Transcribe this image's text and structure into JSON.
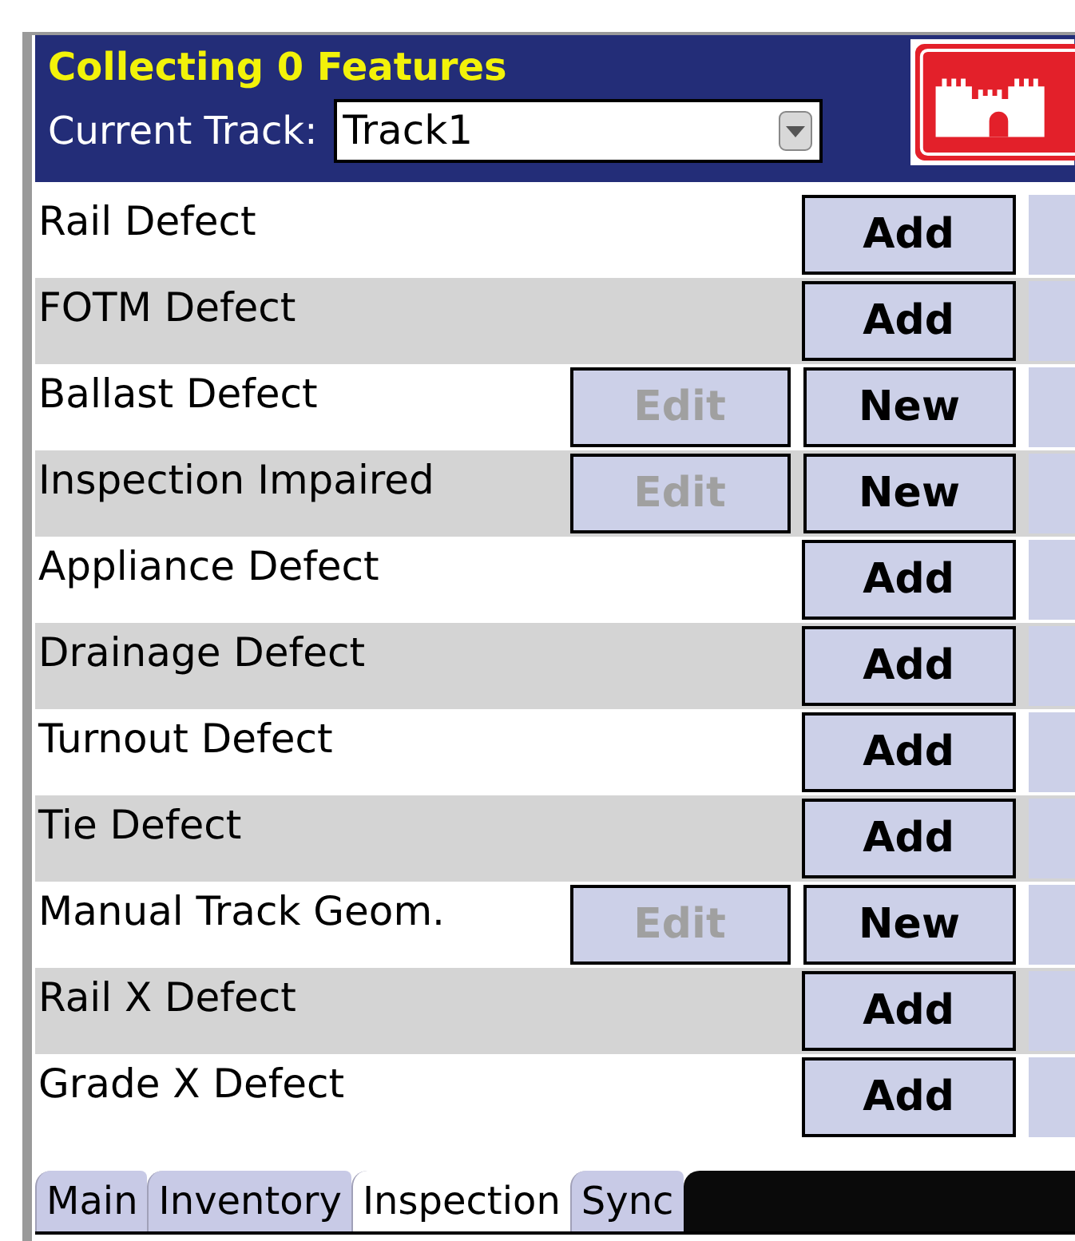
{
  "header": {
    "title": "Collecting 0 Features",
    "track_label": "Current Track:",
    "track_value": "Track1"
  },
  "rows": [
    {
      "label": "Rail Defect",
      "edit": null,
      "action": "Add"
    },
    {
      "label": "FOTM Defect",
      "edit": null,
      "action": "Add"
    },
    {
      "label": "Ballast Defect",
      "edit": {
        "label": "Edit",
        "disabled": true
      },
      "action": "New"
    },
    {
      "label": "Inspection Impaired",
      "edit": {
        "label": "Edit",
        "disabled": true
      },
      "action": "New"
    },
    {
      "label": "Appliance Defect",
      "edit": null,
      "action": "Add"
    },
    {
      "label": "Drainage Defect",
      "edit": null,
      "action": "Add"
    },
    {
      "label": "Turnout Defect",
      "edit": null,
      "action": "Add"
    },
    {
      "label": "Tie Defect",
      "edit": null,
      "action": "Add"
    },
    {
      "label": "Manual Track Geom.",
      "edit": {
        "label": "Edit",
        "disabled": true
      },
      "action": "New"
    },
    {
      "label": "Rail X Defect",
      "edit": null,
      "action": "Add"
    },
    {
      "label": "Grade X Defect",
      "edit": null,
      "action": "Add"
    }
  ],
  "tabs": [
    {
      "label": "Main",
      "selected": false
    },
    {
      "label": "Inventory",
      "selected": false
    },
    {
      "label": "Inspection",
      "selected": true
    },
    {
      "label": "Sync",
      "selected": false
    }
  ]
}
